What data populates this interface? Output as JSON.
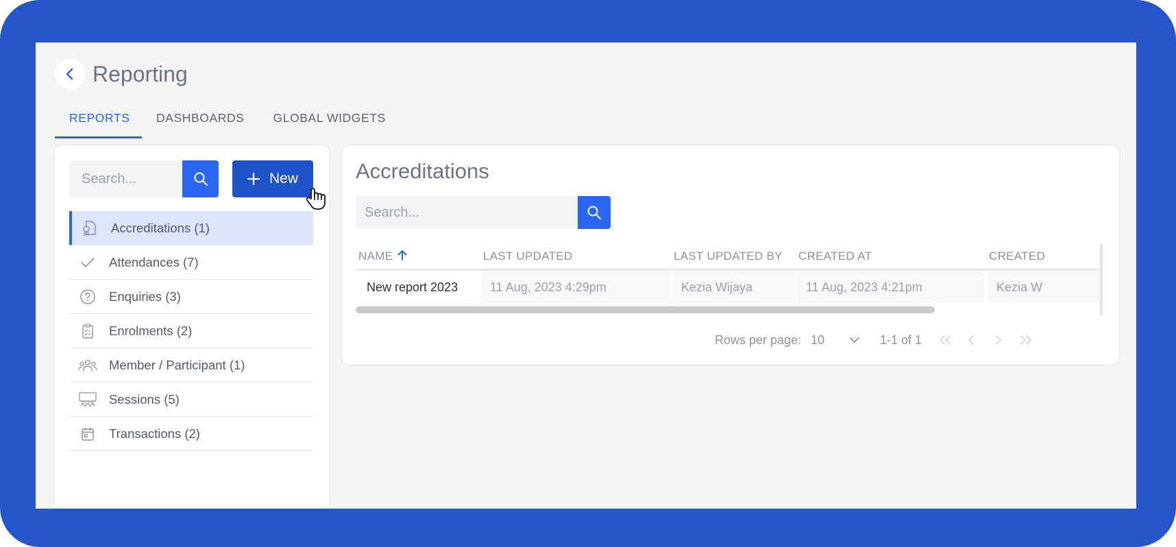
{
  "header": {
    "title": "Reporting"
  },
  "tabs": [
    {
      "label": "REPORTS",
      "active": true
    },
    {
      "label": "DASHBOARDS",
      "active": false
    },
    {
      "label": "GLOBAL WIDGETS",
      "active": false
    }
  ],
  "sidebar": {
    "search_placeholder": "Search...",
    "new_label": "New",
    "items": [
      {
        "label": "Accreditations (1)",
        "icon": "accreditation-icon",
        "active": true
      },
      {
        "label": "Attendances (7)",
        "icon": "check-icon",
        "active": false
      },
      {
        "label": "Enquiries (3)",
        "icon": "question-circle-icon",
        "active": false
      },
      {
        "label": "Enrolments (2)",
        "icon": "clipboard-icon",
        "active": false
      },
      {
        "label": "Member / Participant (1)",
        "icon": "people-icon",
        "active": false
      },
      {
        "label": "Sessions (5)",
        "icon": "sessions-icon",
        "active": false
      },
      {
        "label": "Transactions (2)",
        "icon": "calendar-icon",
        "active": false
      }
    ]
  },
  "main": {
    "title": "Accreditations",
    "search_placeholder": "Search...",
    "table": {
      "columns": [
        "NAME",
        "LAST UPDATED",
        "LAST UPDATED BY",
        "CREATED AT",
        "CREATED"
      ],
      "sort_column": "NAME",
      "sort_direction": "asc",
      "rows": [
        [
          "New report 2023",
          "11 Aug, 2023  4:29pm",
          "Kezia Wijaya",
          "11 Aug, 2023  4:21pm",
          "Kezia W"
        ]
      ]
    },
    "pagination": {
      "rows_per_page_label": "Rows per page:",
      "rows_per_page": "10",
      "range": "1-1 of 1"
    }
  },
  "colors": {
    "frame": "#2656c9",
    "accent": "#2a66e0",
    "button": "#2a66f0",
    "new_button": "#1d52c8"
  }
}
